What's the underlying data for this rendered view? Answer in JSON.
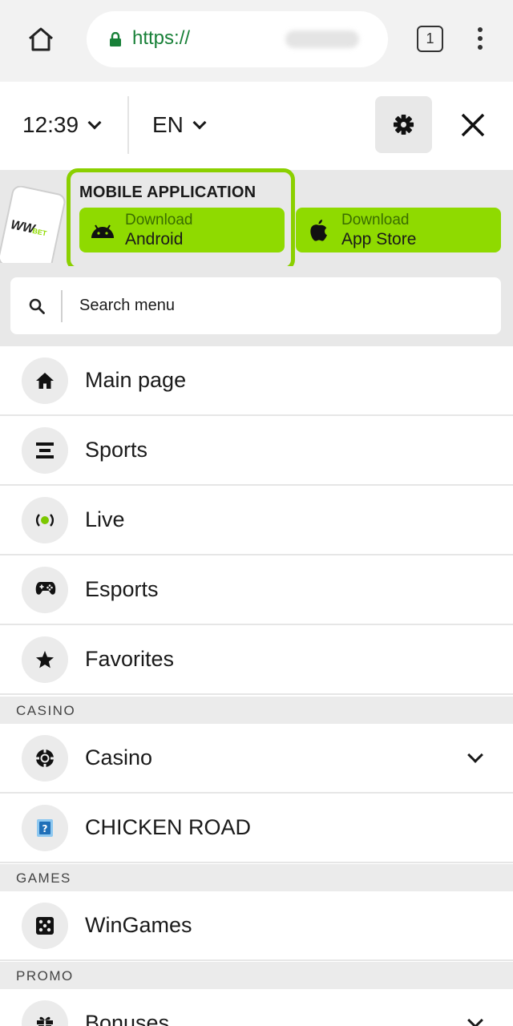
{
  "browser": {
    "url_prefix": "https://",
    "tab_count": "1"
  },
  "header": {
    "time": "12:39",
    "language": "EN"
  },
  "app_banner": {
    "title": "MOBILE APPLICATION",
    "logo_text": "WW BET",
    "android": {
      "small": "Download",
      "big": "Android"
    },
    "appstore": {
      "small": "Download",
      "big": "App Store"
    }
  },
  "search": {
    "placeholder": "Search menu"
  },
  "menu": {
    "main": {
      "label": "Main page"
    },
    "sports": {
      "label": "Sports"
    },
    "live": {
      "label": "Live"
    },
    "esports": {
      "label": "Esports"
    },
    "favorites": {
      "label": "Favorites"
    },
    "casino_section": "CASINO",
    "casino": {
      "label": "Casino"
    },
    "chicken": {
      "label": "CHICKEN ROAD"
    },
    "games_section": "GAMES",
    "wingames": {
      "label": "WinGames"
    },
    "promo_section": "PROMO",
    "bonuses": {
      "label": "Bonuses"
    }
  },
  "colors": {
    "accent_green": "#8fda00",
    "border_green": "#8bd000",
    "url_green": "#188038"
  }
}
